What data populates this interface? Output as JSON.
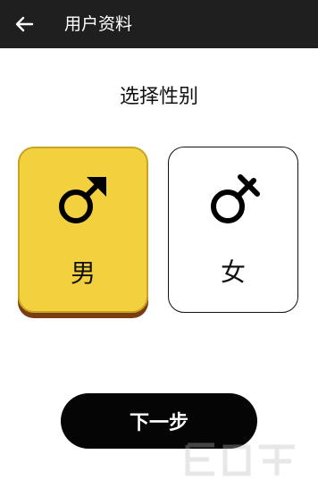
{
  "header": {
    "title": "用户资料",
    "back_icon": "arrow-left-icon",
    "background": "#1f1f1f"
  },
  "prompt": "选择性别",
  "options": {
    "male": {
      "label": "男",
      "icon": "male-symbol-icon",
      "selected": true,
      "color": "#f3d03e"
    },
    "female": {
      "label": "女",
      "icon": "female-symbol-icon",
      "selected": false,
      "color": "#ffffff"
    }
  },
  "next_button": {
    "label": "下一步",
    "color": "#050505"
  }
}
